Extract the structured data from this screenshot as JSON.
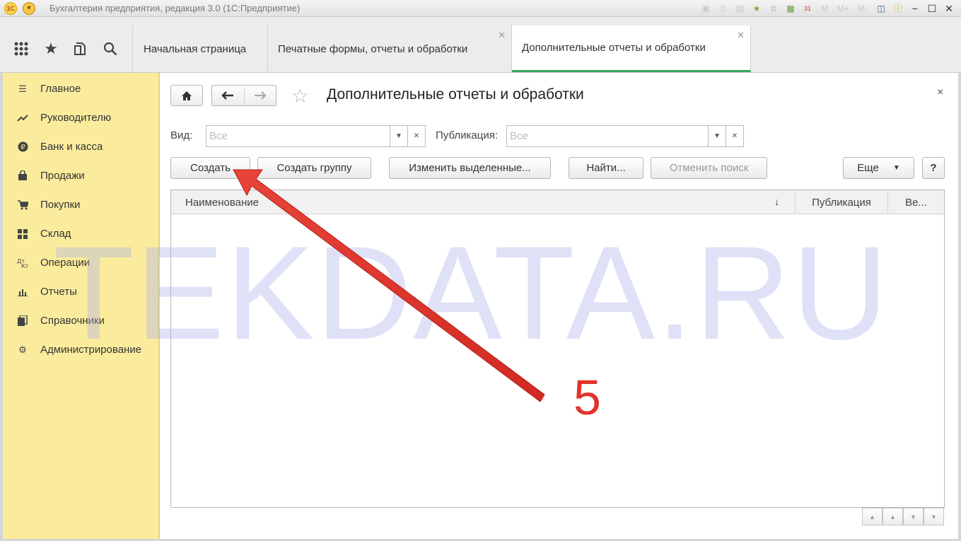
{
  "titlebar": {
    "title": "Бухгалтерия предприятия, редакция 3.0  (1С:Предприятие)",
    "logo_text": "1С",
    "icons": [
      "save-icon",
      "print-icon",
      "preview-icon",
      "favorites-add-icon",
      "bookmark-icon",
      "calculator-icon",
      "calendar-icon",
      "memory-m-icon",
      "memory-mplus-icon",
      "memory-mminus-icon",
      "panel-icon",
      "info-icon",
      "minimize-icon",
      "maximize-icon",
      "close-icon"
    ],
    "calendar_day": "31",
    "m_label": "M",
    "mplus_label": "M+",
    "mminus_label": "M-"
  },
  "tabs": [
    {
      "label": "Начальная страница",
      "closable": false,
      "active": false
    },
    {
      "label": "Печатные формы, отчеты и обработки",
      "closable": true,
      "active": false
    },
    {
      "label": "Дополнительные отчеты и обработки",
      "closable": true,
      "active": true
    }
  ],
  "sidebar": {
    "items": [
      {
        "label": "Главное",
        "icon": "menu-lines-icon"
      },
      {
        "label": "Руководителю",
        "icon": "trend-icon"
      },
      {
        "label": "Банк и касса",
        "icon": "ruble-coin-icon"
      },
      {
        "label": "Продажи",
        "icon": "shopping-bag-icon"
      },
      {
        "label": "Покупки",
        "icon": "cart-icon"
      },
      {
        "label": "Склад",
        "icon": "warehouse-grid-icon"
      },
      {
        "label": "Операции",
        "icon": "operations-icon"
      },
      {
        "label": "Отчеты",
        "icon": "bar-chart-icon"
      },
      {
        "label": "Справочники",
        "icon": "books-icon"
      },
      {
        "label": "Администрирование",
        "icon": "gear-icon"
      }
    ]
  },
  "form": {
    "title": "Дополнительные отчеты и обработки",
    "close_glyph": "×",
    "filters": {
      "vid_label": "Вид:",
      "vid_value": "Все",
      "publication_label": "Публикация:",
      "publication_value": "Все"
    },
    "buttons": {
      "create": "Создать",
      "create_group": "Создать группу",
      "change_selected": "Изменить выделенные...",
      "find": "Найти...",
      "cancel_search": "Отменить поиск",
      "more": "Еще",
      "help": "?"
    },
    "table": {
      "columns": [
        "Наименование",
        "Публикация",
        "Ве..."
      ],
      "sort_indicator": "↓",
      "rows": []
    }
  },
  "overlay": {
    "watermark": "TEKDATA.RU",
    "annotation_number": "5",
    "annotation_color": "#e2322a"
  },
  "colors": {
    "sidebar_bg": "#fbec9d",
    "active_tab_underline": "#3aa55d",
    "watermark": "#aaafeb"
  }
}
